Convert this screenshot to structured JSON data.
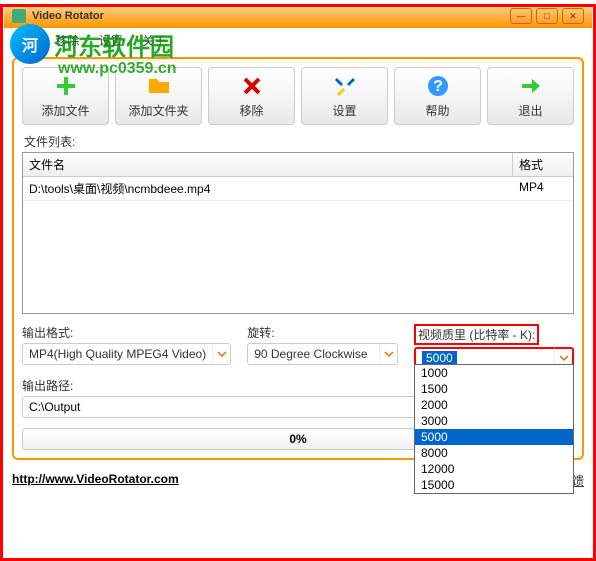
{
  "title": "Video Rotator",
  "watermark": {
    "site_name": "河东软件园",
    "url": "www.pc0359.cn"
  },
  "menu": {
    "file": "文件",
    "remove": "移除",
    "settings": "设置",
    "about": "关于"
  },
  "toolbar": {
    "add_file": "添加文件",
    "add_folder": "添加文件夹",
    "remove": "移除",
    "settings": "设置",
    "help": "帮助",
    "exit": "退出"
  },
  "file_list": {
    "label": "文件列表:",
    "header_name": "文件名",
    "header_format": "格式",
    "rows": [
      {
        "name": "D:\\tools\\桌面\\视频\\ncmbdeee.mp4",
        "format": "MP4"
      }
    ]
  },
  "options": {
    "output_format_label": "输出格式:",
    "output_format_value": "MP4(High Quality MPEG4 Video)",
    "rotate_label": "旋转:",
    "rotate_value": "90 Degree Clockwise",
    "bitrate_label": "视频质里 (比特率 - K):",
    "bitrate_value": "5000",
    "bitrate_options": [
      "1000",
      "1500",
      "2000",
      "3000",
      "5000",
      "8000",
      "12000",
      "15000"
    ]
  },
  "output_path": {
    "label": "输出路径:",
    "value": "C:\\Output"
  },
  "progress": {
    "text": "0%"
  },
  "footer": {
    "url": "http://www.VideoRotator.com",
    "feedback": "反馈"
  }
}
